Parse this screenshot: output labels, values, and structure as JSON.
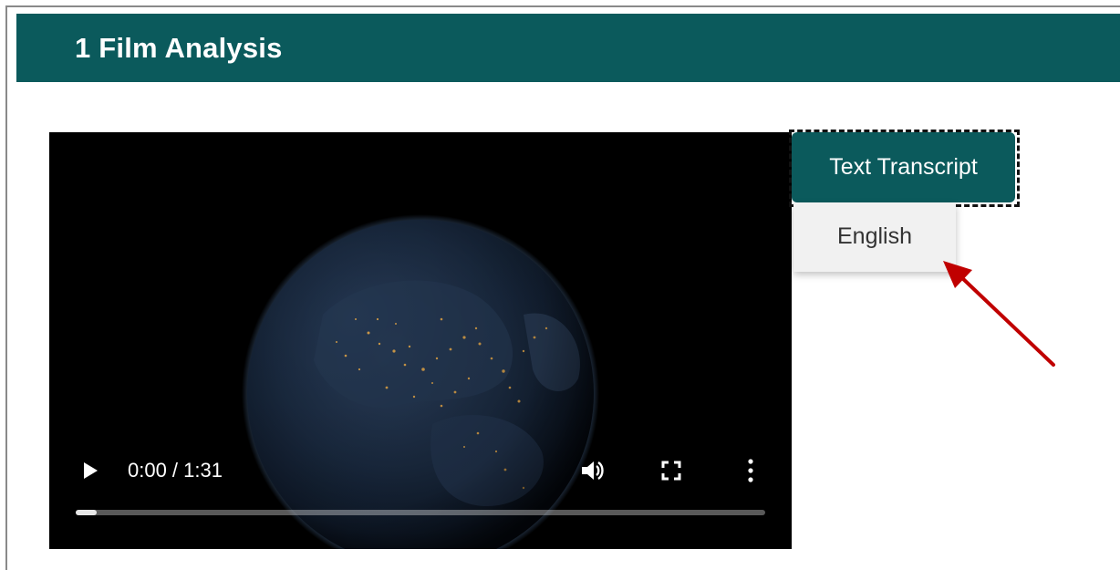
{
  "header": {
    "title": "1 Film Analysis"
  },
  "video_player": {
    "time_display": "0:00 / 1:31",
    "progress_fraction": 0.03,
    "play_icon": "play-icon",
    "volume_icon": "volume-icon",
    "fullscreen_icon": "fullscreen-icon",
    "more_icon": "more-vertical-icon"
  },
  "transcript": {
    "button_label": "Text Transcript",
    "menu_items": [
      {
        "label": "English"
      }
    ]
  },
  "annotation": {
    "arrow_icon": "red-arrow-icon",
    "arrow_color": "#c00000"
  },
  "colors": {
    "brand_teal": "#0b5a5c",
    "menu_bg": "#f1f1f1"
  }
}
